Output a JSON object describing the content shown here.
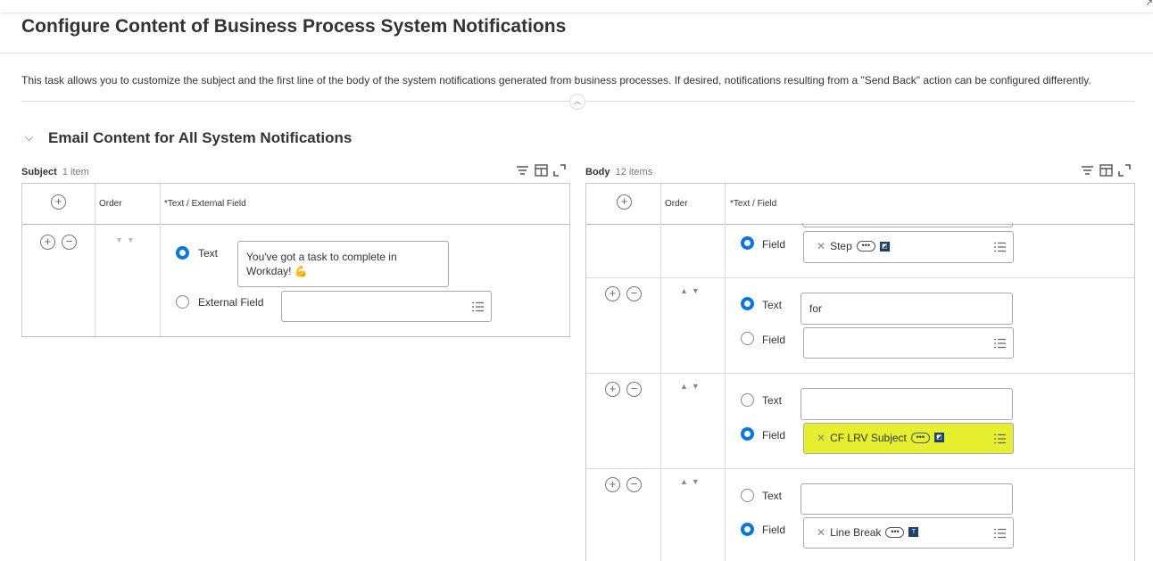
{
  "page": {
    "title": "Configure Content of Business Process System Notifications",
    "description": "This task allows you to customize the subject and the first line of the body of the system notifications generated from business processes. If desired, notifications resulting from a \"Send Back\" action can be configured differently.",
    "section_title": "Email Content for All System Notifications"
  },
  "subject": {
    "label": "Subject",
    "count": "1 item",
    "col_order": "Order",
    "col_text": "*Text / External Field",
    "row": {
      "text_label": "Text",
      "text_value": "You've got a task to complete in Workday! 💪",
      "field_label": "External Field",
      "field_value": ""
    }
  },
  "body": {
    "label": "Body",
    "count": "12 items",
    "col_order": "Order",
    "col_text": "*Text / Field",
    "rows": [
      {
        "field_label": "Field",
        "field_value": "Step",
        "field_icon": "instance-icon"
      },
      {
        "text_label": "Text",
        "text_value": "for",
        "field_label": "Field",
        "field_value": ""
      },
      {
        "text_label": "Text",
        "text_value": "",
        "field_label": "Field",
        "field_value": "CF LRV Subject",
        "field_icon": "instance-icon",
        "highlight": "#e6f030"
      },
      {
        "text_label": "Text",
        "text_value": "",
        "field_label": "Field",
        "field_value": "Line Break",
        "field_icon": "text-type-icon"
      }
    ]
  },
  "colors": {
    "accent": "#0875e1",
    "highlight": "#e6f030"
  }
}
